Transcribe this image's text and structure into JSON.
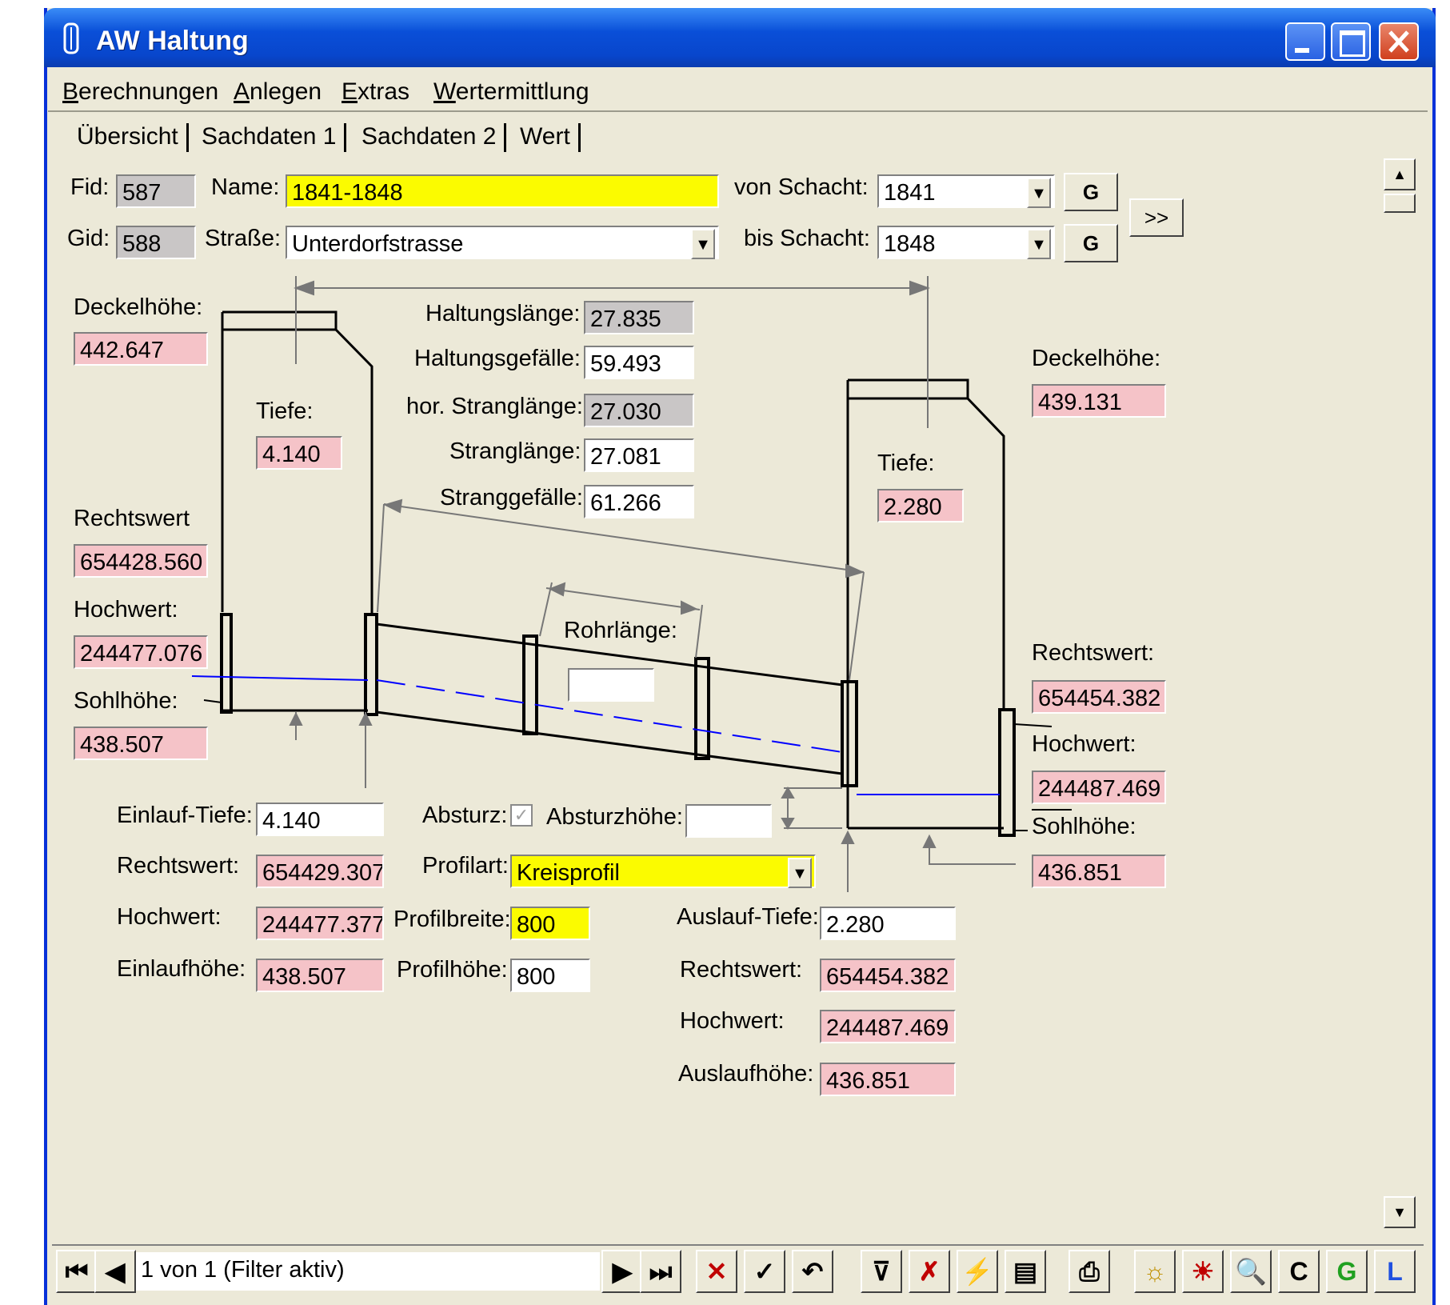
{
  "window": {
    "title": "AW Haltung"
  },
  "menu": [
    "Berechnungen",
    "Anlegen",
    "Extras",
    "Wertermittlung"
  ],
  "tabs": [
    "Übersicht",
    "Sachdaten 1",
    "Sachdaten 2",
    "Wert"
  ],
  "header": {
    "fid_label": "Fid:",
    "fid": "587",
    "gid_label": "Gid:",
    "gid": "588",
    "name_label": "Name:",
    "name": "1841-1848",
    "strasse_label": "Straße:",
    "strasse": "Unterdorfstrasse",
    "von_label": "von Schacht:",
    "von": "1841",
    "bis_label": "bis Schacht:",
    "bis": "1848",
    "g_label": "G",
    "more_label": ">>"
  },
  "left_shaft": {
    "deckel_label": "Deckelhöhe:",
    "deckel": "442.647",
    "tiefe_label": "Tiefe:",
    "tiefe": "4.140",
    "rechts_label": "Rechtswert",
    "rechts": "654428.560",
    "hoch_label": "Hochwert:",
    "hoch": "244477.076",
    "sohl_label": "Sohlhöhe:",
    "sohl": "438.507"
  },
  "right_shaft": {
    "deckel_label": "Deckelhöhe:",
    "deckel": "439.131",
    "tiefe_label": "Tiefe:",
    "tiefe": "2.280",
    "rechts_label": "Rechtswert:",
    "rechts": "654454.382",
    "hoch_label": "Hochwert:",
    "hoch": "244487.469",
    "sohl_label": "Sohlhöhe:",
    "sohl": "436.851"
  },
  "haltung": {
    "laenge_label": "Haltungslänge:",
    "laenge": "27.835",
    "gefaelle_label": "Haltungsgefälle:",
    "gefaelle": "59.493",
    "hor_label": "hor. Stranglänge:",
    "hor": "27.030",
    "strang_label": "Stranglänge:",
    "strang": "27.081",
    "stranggef_label": "Stranggefälle:",
    "stranggef": "61.266",
    "rohr_label": "Rohrlänge:",
    "rohr": ""
  },
  "einlauf": {
    "tiefe_label": "Einlauf-Tiefe:",
    "tiefe": "4.140",
    "rechts_label": "Rechtswert:",
    "rechts": "654429.307",
    "hoch_label": "Hochwert:",
    "hoch": "244477.377",
    "hoehe_label": "Einlaufhöhe:",
    "hoehe": "438.507"
  },
  "profil": {
    "absturz_label": "Absturz:",
    "absturz_checked": true,
    "absturzhoehe_label": "Absturzhöhe:",
    "absturzhoehe": "",
    "art_label": "Profilart:",
    "art": "Kreisprofil",
    "breite_label": "Profilbreite:",
    "breite": "800",
    "hoehe_label": "Profilhöhe:",
    "hoehe": "800"
  },
  "auslauf": {
    "tiefe_label": "Auslauf-Tiefe:",
    "tiefe": "2.280",
    "rechts_label": "Rechtswert:",
    "rechts": "654454.382",
    "hoch_label": "Hochwert:",
    "hoch": "244487.469",
    "hoehe_label": "Auslaufhöhe:",
    "hoehe": "436.851"
  },
  "navigation": {
    "record_text": "1 von 1 (Filter aktiv)",
    "c_label": "C",
    "g_label": "G",
    "l_label": "L"
  }
}
